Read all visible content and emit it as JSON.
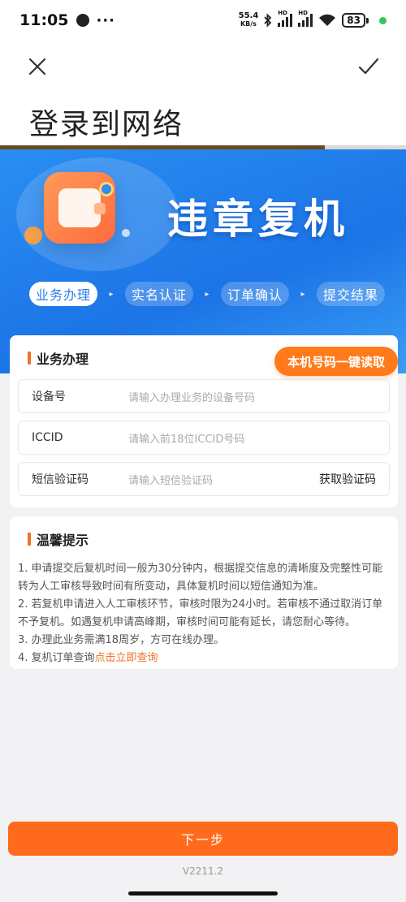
{
  "status": {
    "time": "11:05",
    "more": "···",
    "speed_value": "55.4",
    "speed_unit": "KB/s",
    "hd1": "HD",
    "hd2": "HD",
    "battery": "83"
  },
  "header": {
    "title": "登录到网络",
    "progress": 0.8
  },
  "banner": {
    "title": "违章复机",
    "steps": [
      "业务办理",
      "实名认证",
      "订单确认",
      "提交结果"
    ],
    "active_step": 0
  },
  "form": {
    "section_title": "业务办理",
    "oneclick_label": "本机号码一键读取",
    "fields": [
      {
        "label": "设备号",
        "placeholder": "请输入办理业务的设备号码"
      },
      {
        "label": "ICCID",
        "placeholder": "请输入前18位ICCID号码"
      },
      {
        "label": "短信验证码",
        "placeholder": "请输入短信验证码",
        "action": "获取验证码"
      }
    ]
  },
  "tips": {
    "title": "温馨提示",
    "items": [
      "1. 申请提交后复机时间一般为30分钟内，根据提交信息的清晰度及完整性可能转为人工审核导致时间有所变动，具体复机时间以短信通知为准。",
      "2. 若复机申请进入人工审核环节，审核时限为24小时。若审核不通过取消订单不予复机。如遇复机申请高峰期，审核时间可能有延长，请您耐心等待。",
      "3. 办理此业务需满18周岁，方可在线办理。"
    ],
    "item4_prefix": "4. 复机订单查询",
    "item4_link": "点击立即查询"
  },
  "footer": {
    "next_label": "下一步",
    "version": "V2211.2"
  },
  "colors": {
    "accent": "#ff6a1c",
    "banner": "#1c74e6"
  }
}
